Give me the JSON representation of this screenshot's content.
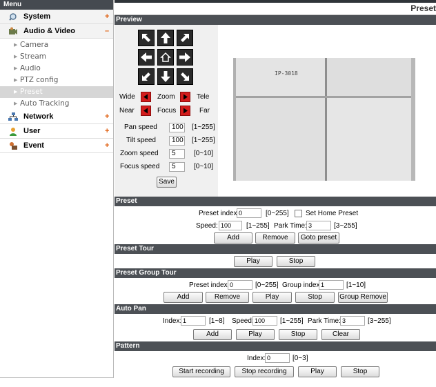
{
  "sidebar": {
    "header": "Menu",
    "categories": [
      {
        "label": "System",
        "sign": "+"
      },
      {
        "label": "Audio & Video",
        "sign": "–"
      },
      {
        "label": "Network",
        "sign": "+"
      },
      {
        "label": "User",
        "sign": "+"
      },
      {
        "label": "Event",
        "sign": "+"
      }
    ],
    "subitems": [
      "Camera",
      "Stream",
      "Audio",
      "PTZ config",
      "Preset",
      "Auto Tracking"
    ],
    "active_subitem": "Preset"
  },
  "page_title": "Preset",
  "sections": {
    "preview": "Preview",
    "preset": "Preset",
    "preset_tour": "Preset Tour",
    "preset_group_tour": "Preset Group Tour",
    "auto_pan": "Auto Pan",
    "pattern": "Pattern"
  },
  "ptz": {
    "wide": "Wide",
    "zoom": "Zoom",
    "tele": "Tele",
    "near": "Near",
    "focus": "Focus",
    "far": "Far",
    "pan_speed_label": "Pan speed",
    "pan_speed": "100",
    "pan_range": "[1~255]",
    "tilt_speed_label": "Tilt speed",
    "tilt_speed": "100",
    "tilt_range": "[1~255]",
    "zoom_speed_label": "Zoom speed",
    "zoom_speed": "5",
    "zoom_range": "[0~10]",
    "focus_speed_label": "Focus speed",
    "focus_speed": "5",
    "focus_range": "[0~10]",
    "save": "Save"
  },
  "camera_overlay_text": "IP-3018",
  "preset": {
    "index_label": "Preset index:",
    "index_value": "0",
    "index_range": "[0~255]",
    "set_home": "Set Home Preset",
    "speed_label": "Speed:",
    "speed_value": "100",
    "speed_range": "[1~255]",
    "park_label": "Park Time:",
    "park_value": "3",
    "park_range": "[3~255]",
    "add": "Add",
    "remove": "Remove",
    "goto": "Goto preset"
  },
  "preset_tour": {
    "play": "Play",
    "stop": "Stop"
  },
  "group_tour": {
    "index_label": "Preset index:",
    "index_value": "0",
    "index_range": "[0~255]",
    "group_label": "Group index:",
    "group_value": "1",
    "group_range": "[1~10]",
    "add": "Add",
    "remove": "Remove",
    "play": "Play",
    "stop": "Stop",
    "group_remove": "Group Remove"
  },
  "auto_pan": {
    "index_label": "Index:",
    "index_value": "1",
    "index_range": "[1~8]",
    "speed_label": "Speed:",
    "speed_value": "100",
    "speed_range": "[1~255]",
    "park_label": "Park Time:",
    "park_value": "3",
    "park_range": "[3~255]",
    "add": "Add",
    "play": "Play",
    "stop": "Stop",
    "clear": "Clear"
  },
  "pattern": {
    "index_label": "Index:",
    "index_value": "0",
    "index_range": "[0~3]",
    "start": "Start recording",
    "stop_rec": "Stop recording",
    "play": "Play",
    "stop": "Stop"
  }
}
